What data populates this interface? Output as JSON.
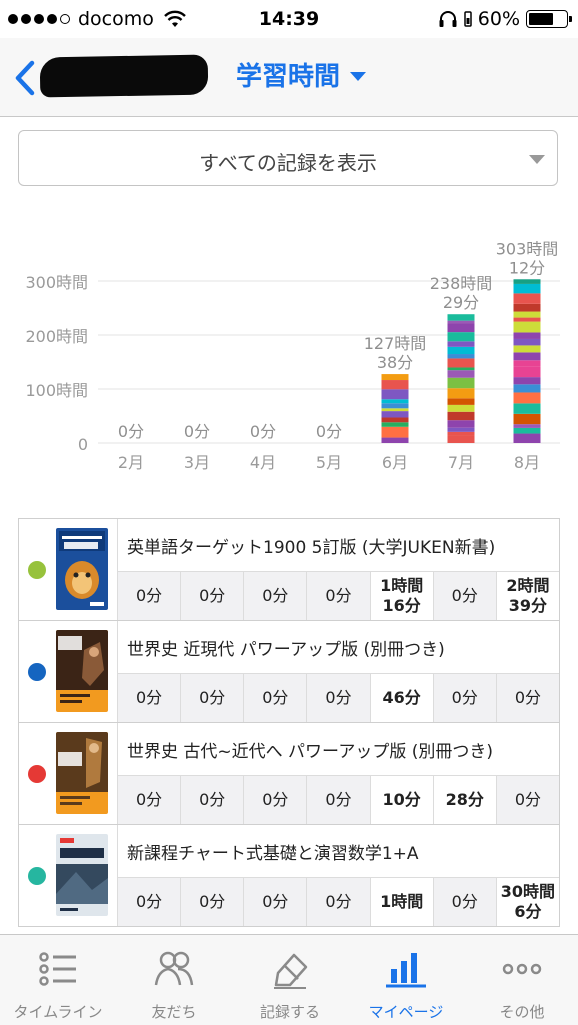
{
  "status_bar": {
    "carrier": "docomo",
    "time": "14:39",
    "battery": "60%"
  },
  "nav": {
    "title": "学習時間"
  },
  "filter": {
    "label": "すべての記録を表示"
  },
  "chart_data": {
    "type": "bar",
    "stacked": true,
    "categories": [
      "2月",
      "3月",
      "4月",
      "5月",
      "6月",
      "7月",
      "8月"
    ],
    "values_hours": [
      0,
      0,
      0,
      0,
      127.63,
      238.48,
      303.2
    ],
    "value_labels": [
      [
        "0分"
      ],
      [
        "0分"
      ],
      [
        "0分"
      ],
      [
        "0分"
      ],
      [
        "127時間",
        "38分"
      ],
      [
        "238時間",
        "29分"
      ],
      [
        "303時間",
        "12分"
      ]
    ],
    "y_ticks": [
      "0",
      "100時間",
      "200時間",
      "300時間"
    ],
    "y_tick_values": [
      0,
      100,
      200,
      300
    ],
    "ylim": [
      0,
      300
    ],
    "grid": true
  },
  "books": [
    {
      "title": "英単語ターゲット1900 5訂版 (大学JUKEN新書)",
      "dot_color": "#97c23c",
      "cells": [
        "0分",
        "0分",
        "0分",
        "0分",
        "1時間\n16分",
        "0分",
        "2時間\n39分"
      ],
      "highlighted": [
        4,
        6
      ]
    },
    {
      "title": "世界史 近現代 パワーアップ版 (別冊つき)",
      "dot_color": "#1565c0",
      "cells": [
        "0分",
        "0分",
        "0分",
        "0分",
        "46分",
        "0分",
        "0分"
      ],
      "highlighted": [
        4
      ]
    },
    {
      "title": "世界史 古代~近代へ パワーアップ版 (別冊つき)",
      "dot_color": "#e53935",
      "cells": [
        "0分",
        "0分",
        "0分",
        "0分",
        "10分",
        "28分",
        "0分"
      ],
      "highlighted": [
        4,
        5
      ]
    },
    {
      "title": "新課程チャート式基礎と演習数学1+A",
      "dot_color": "#26b6a0",
      "cells": [
        "0分",
        "0分",
        "0分",
        "0分",
        "1時間",
        "0分",
        "30時間\n6分"
      ],
      "highlighted": [
        4,
        6
      ]
    }
  ],
  "tabs": [
    {
      "label": "タイムライン",
      "icon": "list-icon"
    },
    {
      "label": "友だち",
      "icon": "friends-icon"
    },
    {
      "label": "記録する",
      "icon": "pencil-icon"
    },
    {
      "label": "マイページ",
      "icon": "chart-icon",
      "active": true
    },
    {
      "label": "その他",
      "icon": "more-icon"
    }
  ]
}
